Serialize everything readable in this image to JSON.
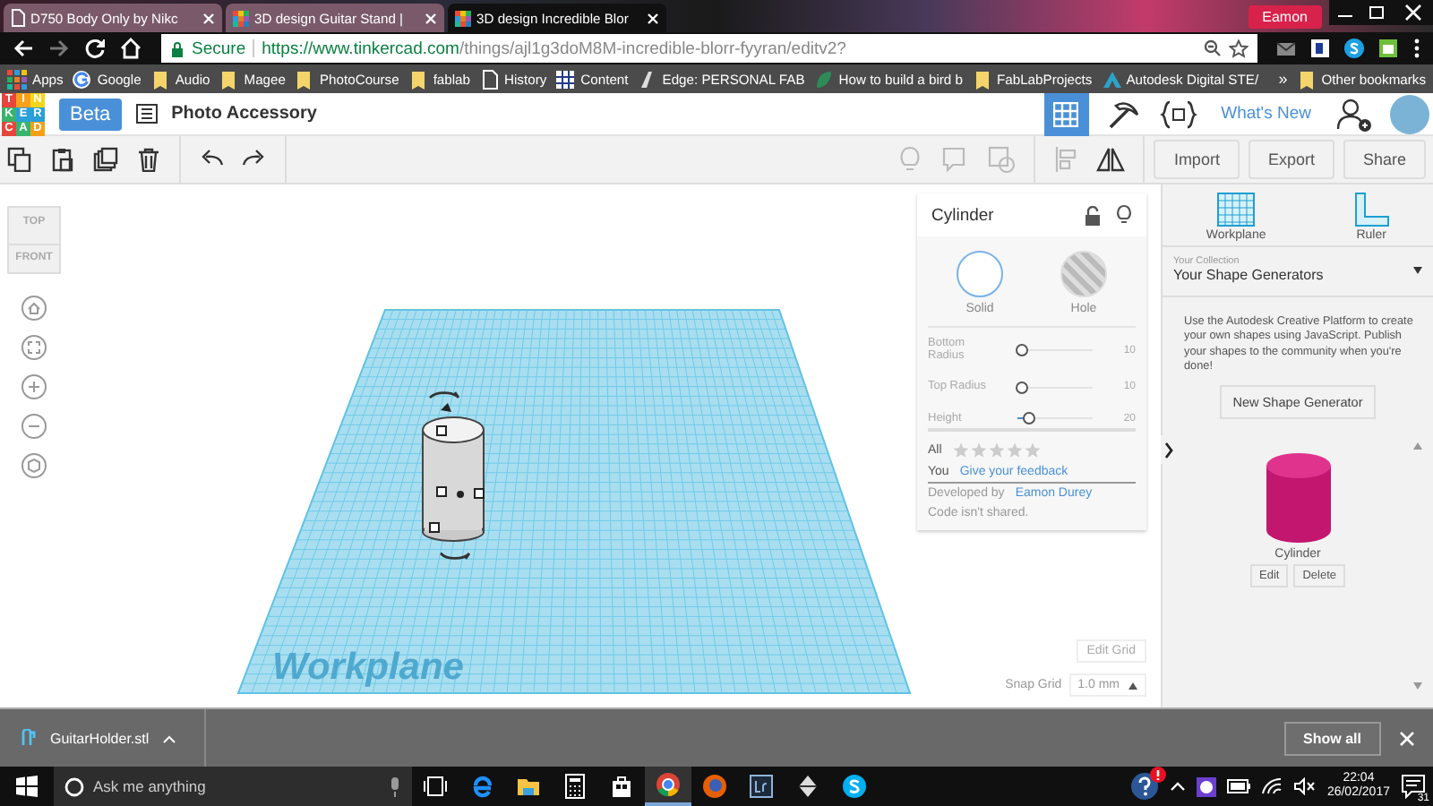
{
  "browser": {
    "tabs": [
      {
        "title": "D750 Body Only by Nikc",
        "selected": false
      },
      {
        "title": "3D design Guitar Stand |",
        "selected": false
      },
      {
        "title": "3D design Incredible Blor",
        "selected": true
      }
    ],
    "profile": "Eamon",
    "address": {
      "secure": "Secure",
      "url_host": "https://www.tinkercad.com",
      "url_path": "/things/ajl1g3doM8M-incredible-blorr-fyyran/editv2?"
    },
    "bookmarks": [
      {
        "label": "Apps",
        "kind": "apps"
      },
      {
        "label": "Google",
        "kind": "google"
      },
      {
        "label": "Audio",
        "kind": "folder"
      },
      {
        "label": "Magee",
        "kind": "folder"
      },
      {
        "label": "PhotoCourse",
        "kind": "folder"
      },
      {
        "label": "fablab",
        "kind": "folder"
      },
      {
        "label": "History",
        "kind": "page"
      },
      {
        "label": "Content",
        "kind": "grid"
      },
      {
        "label": "Edge: PERSONAL FAB",
        "kind": "edge"
      },
      {
        "label": "How to build a bird b",
        "kind": "leaf"
      },
      {
        "label": "FabLabProjects",
        "kind": "folder"
      },
      {
        "label": "Autodesk Digital STE/",
        "kind": "autodesk"
      }
    ],
    "more": "»",
    "other_bookmarks": "Other bookmarks"
  },
  "app": {
    "logo": [
      "T",
      "I",
      "N",
      "K",
      "E",
      "R",
      "C",
      "A",
      "D"
    ],
    "beta": "Beta",
    "project_title": "Photo Accessory",
    "whats_new": "What's New"
  },
  "toolbar": {
    "buttons": [
      "Import",
      "Export",
      "Share"
    ]
  },
  "view_cube": {
    "top": "TOP",
    "front": "FRONT"
  },
  "workplane": {
    "label": "Workplane"
  },
  "inspector": {
    "title": "Cylinder",
    "options": [
      {
        "label": "Solid",
        "selected": true
      },
      {
        "label": "Hole",
        "selected": false
      }
    ],
    "params": [
      {
        "label": "Bottom Radius",
        "level": 0.05,
        "reading": "10"
      },
      {
        "label": "Top Radius",
        "level": 0.05,
        "reading": "10"
      },
      {
        "label": "Height",
        "level": 0.14,
        "reading": "20"
      }
    ],
    "rating": {
      "label": "All",
      "stars": 0
    },
    "feedback": {
      "label": "You",
      "link": "Give your feedback"
    },
    "developer": {
      "label": "Developed by",
      "name": "Eamon Durey"
    },
    "note": "Code isn't shared."
  },
  "grid": {
    "edit": "Edit Grid",
    "snap_label": "Snap Grid",
    "snap_value": "1.0 mm"
  },
  "sidebar": {
    "tools": [
      {
        "label": "Workplane",
        "kind": "workplane"
      },
      {
        "label": "Ruler",
        "kind": "ruler"
      }
    ],
    "collection_caption": "Your Collection",
    "collection": "Your Shape Generators",
    "description": "Use the Autodesk Creative Platform to create your own shapes using JavaScript. Publish your shapes to the community when you're done!",
    "new_button": "New Shape Generator",
    "shape": {
      "name": "Cylinder",
      "actions": [
        "Edit",
        "Delete"
      ]
    }
  },
  "download": {
    "file": "GuitarHolder.stl",
    "show_all": "Show all"
  },
  "taskbar": {
    "search": "Ask me anything",
    "time": "22:04",
    "date": "26/02/2017",
    "notifications": "31"
  }
}
